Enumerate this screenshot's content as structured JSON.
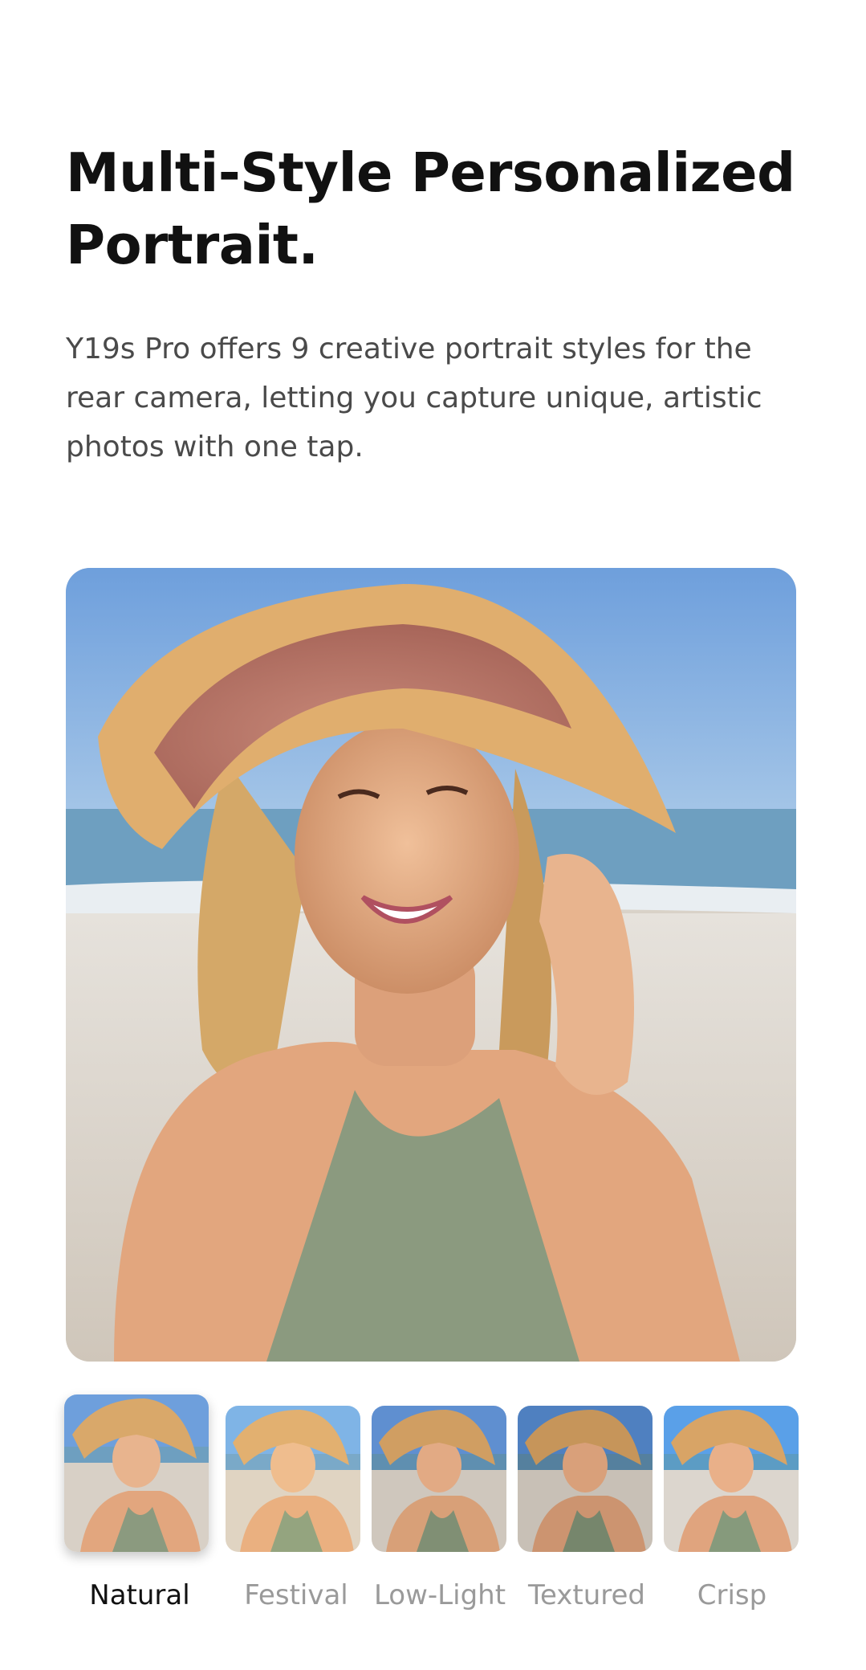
{
  "heading": {
    "title": "Multi-Style Personalized Portrait.",
    "description": "Y19s Pro offers 9 creative portrait styles for the rear camera, letting you capture unique, artistic photos with one tap."
  },
  "styles": {
    "selected": "Natural",
    "items": [
      {
        "label": "Natural"
      },
      {
        "label": "Festival"
      },
      {
        "label": "Low-Light"
      },
      {
        "label": "Textured"
      },
      {
        "label": "Crisp"
      }
    ]
  },
  "colors": {
    "sky": "#7fb0e4",
    "sea": "#6c9fc2",
    "sand": "#d8d0c6",
    "hat": "#d9a86a",
    "swimsuit": "#8a9a7e",
    "skin": "#e6b08c",
    "hair": "#d8b070"
  }
}
